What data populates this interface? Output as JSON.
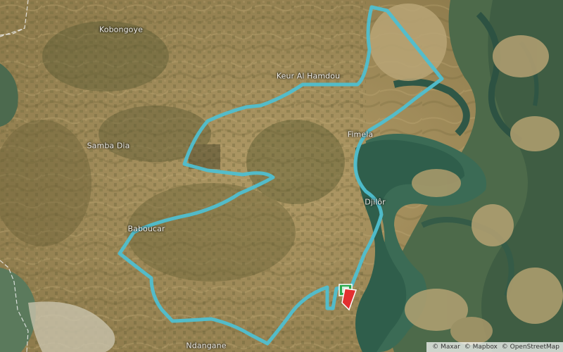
{
  "places": {
    "kobongoye": "Kobongoye",
    "keur_al_hamdou": "Keur Al Hamdou",
    "samba_dia": "Samba Dia",
    "fimela": "Fimela",
    "djilor": "Djilôr",
    "baboucar": "Baboucar",
    "ndangane": "Ndangane"
  },
  "attribution": {
    "maxar": "© Maxar",
    "mapbox": "© Mapbox",
    "osm": "© OpenStreetMap"
  },
  "style": {
    "route_color": "#4fbfd0",
    "start_flag_color": "#2aa84a",
    "finish_flag_color": "#e23030"
  },
  "icons": {
    "start_marker": "start-flag-icon",
    "finish_marker": "finish-flag-icon"
  }
}
